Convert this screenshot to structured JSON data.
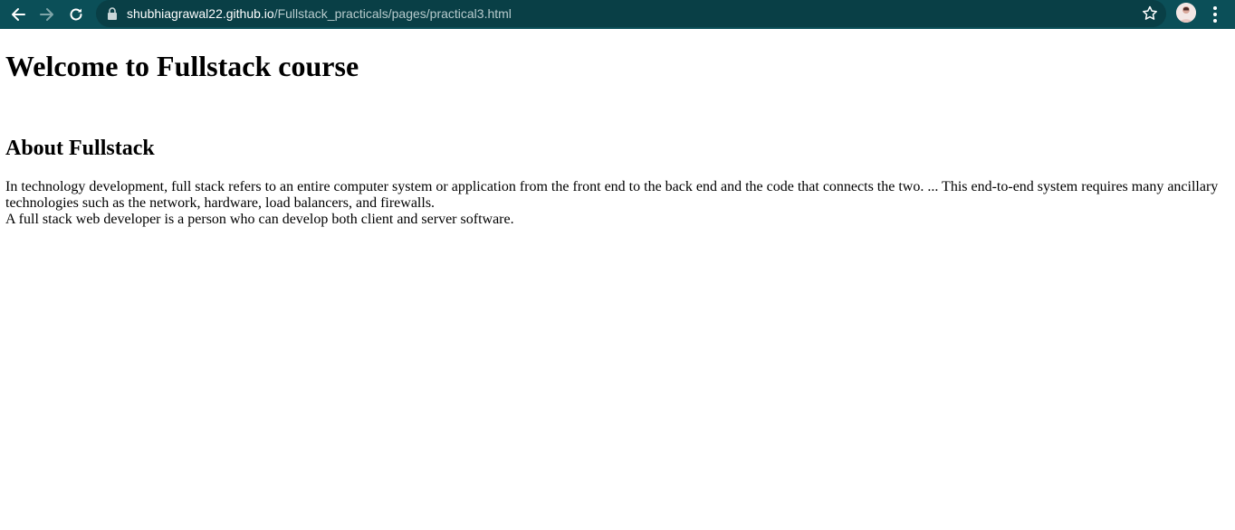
{
  "browser": {
    "url_host": "shubhiagrawal22.github.io",
    "url_path": "/Fullstack_practicals/pages/practical3.html",
    "icons": {
      "back": "arrow-left-icon",
      "forward": "arrow-right-icon",
      "reload": "reload-icon",
      "lock": "lock-icon",
      "bookmark": "star-icon",
      "profile": "avatar",
      "menu": "kebab-menu-icon"
    },
    "colors": {
      "toolbar": "#0b4f58",
      "omnibox": "#093f46"
    }
  },
  "page": {
    "heading": "Welcome to Fullstack course",
    "subheading": "About Fullstack",
    "paragraph_line1": "In technology development, full stack refers to an entire computer system or application from the front end to the back end and the code that connects the two. ... This end-to-end system requires many ancillary technologies such as the network, hardware, load balancers, and firewalls.",
    "paragraph_line2": "A full stack web developer is a person who can develop both client and server software."
  }
}
